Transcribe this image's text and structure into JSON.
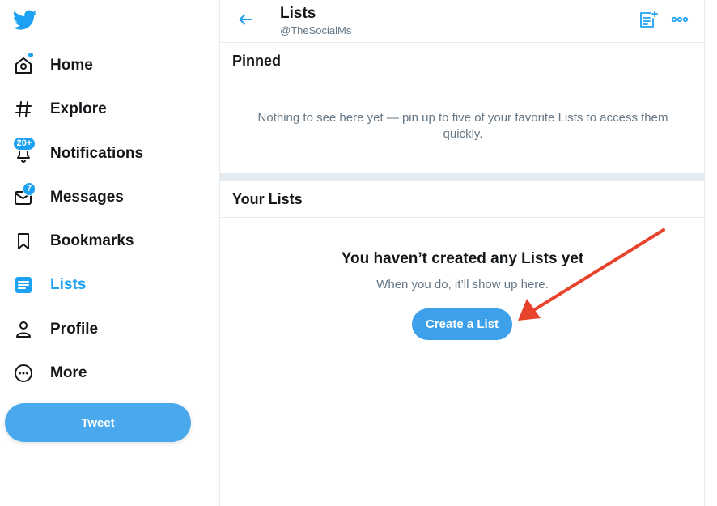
{
  "sidebar": {
    "items": [
      {
        "label": "Home",
        "icon": "home-icon"
      },
      {
        "label": "Explore",
        "icon": "hashtag-icon"
      },
      {
        "label": "Notifications",
        "icon": "bell-icon",
        "badge": "20+"
      },
      {
        "label": "Messages",
        "icon": "envelope-icon",
        "badge": "7"
      },
      {
        "label": "Bookmarks",
        "icon": "bookmark-icon"
      },
      {
        "label": "Lists",
        "icon": "lists-icon",
        "active": true
      },
      {
        "label": "Profile",
        "icon": "person-icon"
      },
      {
        "label": "More",
        "icon": "more-circle-icon"
      }
    ],
    "tweet_label": "Tweet"
  },
  "header": {
    "title": "Lists",
    "handle": "@TheSocialMs"
  },
  "pinned": {
    "title": "Pinned",
    "message": "Nothing to see here yet — pin up to five of your favorite Lists to access them quickly."
  },
  "your_lists": {
    "title": "Your Lists",
    "empty_title": "You haven’t created any Lists yet",
    "empty_subtitle": "When you do, it’ll show up here.",
    "create_label": "Create a List"
  },
  "colors": {
    "accent": "#1da1f2",
    "annotation_arrow": "#e8432c",
    "divider": "#e6ecf0"
  }
}
